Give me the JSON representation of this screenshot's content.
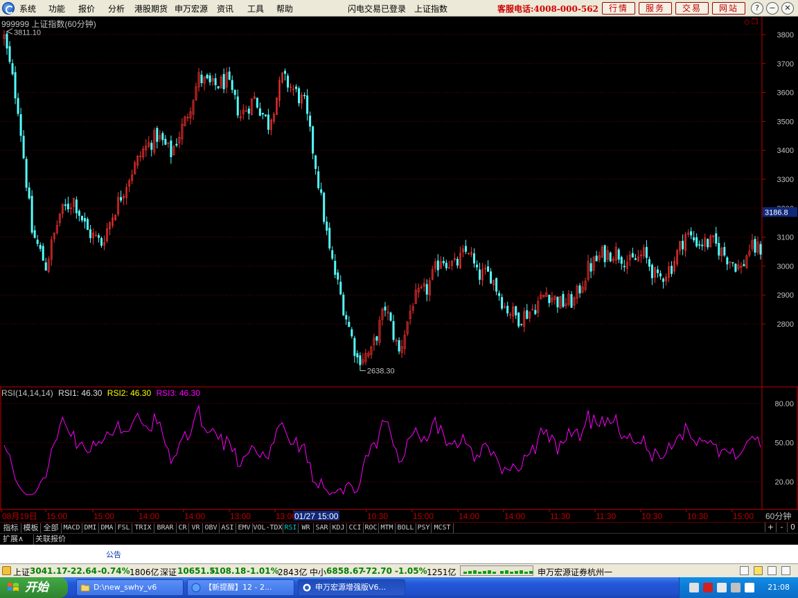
{
  "menu": {
    "items": [
      "系统",
      "功能",
      "报价",
      "分析",
      "港股期货",
      "申万宏源",
      "资讯",
      "工具",
      "帮助"
    ],
    "login_status": "闪电交易已登录",
    "index_name": "上证指数",
    "hotline": "客服电话:4008-000-562",
    "buttons": [
      "行情",
      "服务",
      "交易",
      "网站"
    ],
    "window_controls": [
      "?",
      "−",
      "❐",
      "✕"
    ]
  },
  "chart": {
    "title": "999999 上证指数(60分钟)",
    "high_label": "3811.10",
    "low_label": "2638.30",
    "current_price_tag": "3186.8",
    "price_ticks": [
      "3800",
      "3700",
      "3600",
      "3500",
      "3400",
      "3300",
      "3200",
      "3100",
      "3000",
      "2900",
      "2800"
    ],
    "rsi": {
      "label": "RSI(14,14,14)",
      "rsi1": "RSI1: 46.30",
      "rsi2": "RSI2: 46.30",
      "rsi3": "RSI3: 46.30",
      "ticks": [
        "80.00",
        "50.00",
        "20.00"
      ]
    },
    "time_labels": [
      "08月19日",
      "15:00",
      "15:00",
      "14:00",
      "14:00",
      "13:00",
      "13:00",
      "01/27 15:00",
      "10:30",
      "15:00",
      "14:00",
      "14:00",
      "11:30",
      "11:30",
      "10:30",
      "10:30",
      "15:00"
    ],
    "period": "60分钟",
    "colors": {
      "up": "#ff3232",
      "down": "#54ffff",
      "rsi": "#ff00ff",
      "grid": "#800000",
      "axis": "#c00000"
    }
  },
  "chart_data": {
    "type": "candlestick",
    "title": "999999 上证指数(60分钟)",
    "ylim": [
      2600,
      3850
    ],
    "y_ticks": [
      2800,
      2900,
      3000,
      3100,
      3200,
      3300,
      3400,
      3500,
      3600,
      3700,
      3800
    ],
    "annotations": [
      {
        "text": "3811.10",
        "value": 3811.1
      },
      {
        "text": "2638.30",
        "value": 2638.3
      }
    ],
    "last_price": 3186.8,
    "close_path": [
      [
        0,
        3790
      ],
      [
        5,
        3550
      ],
      [
        10,
        3120
      ],
      [
        15,
        3000
      ],
      [
        20,
        3180
      ],
      [
        25,
        3230
      ],
      [
        30,
        3120
      ],
      [
        35,
        3080
      ],
      [
        40,
        3200
      ],
      [
        45,
        3310
      ],
      [
        50,
        3400
      ],
      [
        55,
        3450
      ],
      [
        60,
        3390
      ],
      [
        65,
        3500
      ],
      [
        70,
        3650
      ],
      [
        75,
        3620
      ],
      [
        80,
        3640
      ],
      [
        85,
        3520
      ],
      [
        90,
        3580
      ],
      [
        95,
        3490
      ],
      [
        100,
        3650
      ],
      [
        104,
        3610
      ],
      [
        108,
        3560
      ],
      [
        112,
        3350
      ],
      [
        117,
        3050
      ],
      [
        122,
        2860
      ],
      [
        127,
        2680
      ],
      [
        132,
        2700
      ],
      [
        137,
        2860
      ],
      [
        142,
        2700
      ],
      [
        147,
        2880
      ],
      [
        152,
        2920
      ],
      [
        157,
        3030
      ],
      [
        162,
        3000
      ],
      [
        167,
        3060
      ],
      [
        170,
        2970
      ],
      [
        175,
        2970
      ],
      [
        180,
        2860
      ],
      [
        185,
        2820
      ],
      [
        190,
        2850
      ],
      [
        195,
        2910
      ],
      [
        200,
        2870
      ],
      [
        205,
        2880
      ],
      [
        210,
        2990
      ],
      [
        215,
        3040
      ],
      [
        220,
        3050
      ],
      [
        225,
        3010
      ],
      [
        230,
        3040
      ],
      [
        235,
        2950
      ],
      [
        240,
        3000
      ],
      [
        245,
        3110
      ],
      [
        250,
        3080
      ],
      [
        255,
        3080
      ],
      [
        260,
        3030
      ],
      [
        265,
        2990
      ],
      [
        268,
        3060
      ],
      [
        272,
        3060
      ]
    ],
    "rsi_ylim": [
      0,
      100
    ],
    "rsi_ticks": [
      20,
      50,
      80
    ],
    "rsi_last": 46.3
  },
  "tabs": [
    "指标",
    "模板",
    "全部",
    "MACD",
    "DMI",
    "DMA",
    "FSL",
    "TRIX",
    "BRAR",
    "CR",
    "VR",
    "OBV",
    "ASI",
    "EMV",
    "VOL-TDX",
    "RSI",
    "WR",
    "SAR",
    "KDJ",
    "CCI",
    "ROC",
    "MTM",
    "BOLL",
    "PSY",
    "MCST"
  ],
  "active_tab": "RSI",
  "right_controls": [
    "+",
    "-",
    "0"
  ],
  "extension": [
    "扩展∧",
    "关联报价"
  ],
  "notice": "公告",
  "status": {
    "sh_name": "上证",
    "sh_val": "3041.17",
    "sh_chg": "-22.64",
    "sh_pct": "-0.74%",
    "sh_amt": "1806亿",
    "sz_name": "深证",
    "sz_val": "10651.5",
    "sz_chg": "-108.18",
    "sz_pct": "-1.01%",
    "sz_amt": "2843亿",
    "zx_name": "中小",
    "zx_val": "6858.67",
    "zx_chg": "-72.70",
    "zx_pct": "-1.05%",
    "zx_amt": "1251亿",
    "broker": "申万宏源证券杭州一"
  },
  "taskbar": {
    "start": "开始",
    "tasks": [
      "D:\\new_swhy_v6",
      "【新提醒】12 - 2...",
      "申万宏源增强版V6..."
    ],
    "clock": "21:08"
  }
}
